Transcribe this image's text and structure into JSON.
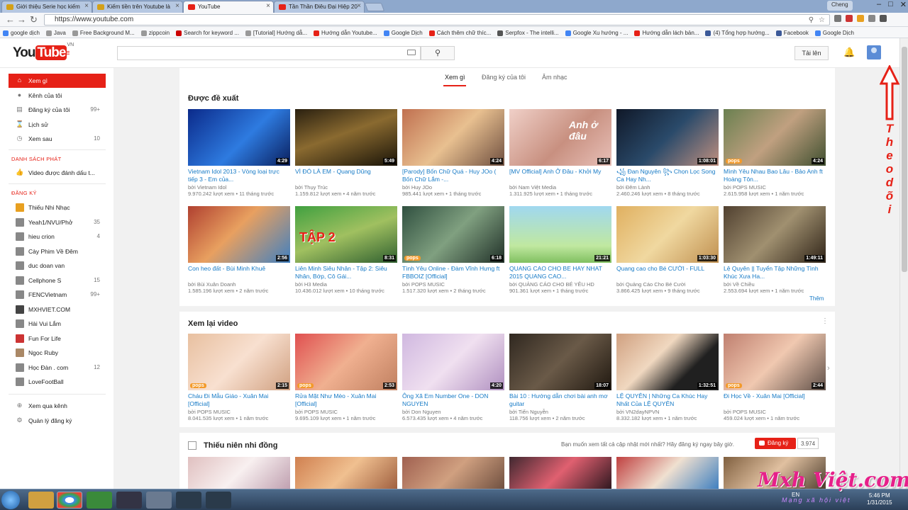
{
  "browser": {
    "tabs": [
      {
        "label": "Giới thiệu Serie học kiếm",
        "fav": "#d4a017"
      },
      {
        "label": "Kiếm tiền trên Youtube là",
        "fav": "#d4a017"
      },
      {
        "label": "YouTube",
        "fav": "#e62117"
      },
      {
        "label": "Tần Thần Điêu Đại Hiệp 20",
        "fav": "#e62117"
      }
    ],
    "user_chip": "Cheng",
    "url": "https://www.youtube.com",
    "bookmarks": [
      {
        "label": "google dịch",
        "color": "#4285f4"
      },
      {
        "label": "Java",
        "color": "#999"
      },
      {
        "label": "Free Background M...",
        "color": "#999"
      },
      {
        "label": "zippcoin",
        "color": "#999"
      },
      {
        "label": "Search for keyword ...",
        "color": "#c00"
      },
      {
        "label": "[Tutorial] Hướng dẫ...",
        "color": "#999"
      },
      {
        "label": "Hướng dẫn Youtube...",
        "color": "#e62117"
      },
      {
        "label": "Google Dịch",
        "color": "#4285f4"
      },
      {
        "label": "Cách thêm chữ thíc...",
        "color": "#e62117"
      },
      {
        "label": "Serpfox - The intelli...",
        "color": "#555"
      },
      {
        "label": "Google Xu hướng - ...",
        "color": "#4285f4"
      },
      {
        "label": "Hướng dẫn lách bản...",
        "color": "#e62117"
      },
      {
        "label": "(4) Tổng hợp hướng...",
        "color": "#3b5998"
      },
      {
        "label": "Facebook",
        "color": "#3b5998"
      },
      {
        "label": "Google Dịch",
        "color": "#4285f4"
      }
    ]
  },
  "yt": {
    "logo_you": "You",
    "logo_tube": "Tube",
    "logo_country": "VN",
    "upload_label": "Tải lên",
    "top_tabs": [
      "Xem gì",
      "Đăng ký của tôi",
      "Âm nhạc"
    ],
    "section_recommended": "Được đề xuất",
    "section_watch_again": "Xem lại video",
    "section_kids": "Thiếu niên nhi đồng",
    "more_label": "Thêm",
    "subscribe_prompt": "Bạn muốn xem tất cả cập nhật mới nhất? Hãy đăng ký ngay bây giờ.",
    "subscribe_label": "Đăng ký",
    "subscribe_count": "3.974"
  },
  "sidebar": {
    "main": [
      {
        "label": "Xem gì",
        "icon": "home-icon",
        "count": ""
      },
      {
        "label": "Kênh của tôi",
        "icon": "user-icon",
        "count": ""
      },
      {
        "label": "Đăng ký của tôi",
        "icon": "subscriptions-icon",
        "count": "99+"
      },
      {
        "label": "Lịch sử",
        "icon": "history-icon",
        "count": ""
      },
      {
        "label": "Xem sau",
        "icon": "clock-icon",
        "count": "10"
      }
    ],
    "playlist_heading": "DANH SÁCH PHÁT",
    "playlists": [
      {
        "label": "Video được đánh dấu t...",
        "icon": "like-icon"
      }
    ],
    "subs_heading": "ĐĂNG KÝ",
    "subscriptions": [
      {
        "label": "Thiếu Nhi Nhạc",
        "count": "",
        "color": "#e8a020"
      },
      {
        "label": "Yeah1/NVU/Phở",
        "count": "35",
        "color": "#888"
      },
      {
        "label": "hieu crion",
        "count": "4",
        "color": "#888"
      },
      {
        "label": "Cày Phim Về Đêm",
        "count": "",
        "color": "#888"
      },
      {
        "label": "duc doan van",
        "count": "",
        "color": "#888"
      },
      {
        "label": "Cellphone S",
        "count": "15",
        "color": "#888"
      },
      {
        "label": "FENCVietnam",
        "count": "99+",
        "color": "#888"
      },
      {
        "label": "MXHVIET.COM",
        "count": "",
        "color": "#444"
      },
      {
        "label": "Hài Vui Lắm",
        "count": "",
        "color": "#888"
      },
      {
        "label": "Fun For Life",
        "count": "",
        "color": "#c33"
      },
      {
        "label": "Ngọc Ruby",
        "count": "",
        "color": "#a86"
      },
      {
        "label": "Học Đàn . com",
        "count": "12",
        "color": "#888"
      },
      {
        "label": "LoveFootBall",
        "count": "",
        "color": "#888"
      }
    ],
    "footer": [
      {
        "label": "Xem qua kênh",
        "icon": "plus-circle-icon"
      },
      {
        "label": "Quản lý đăng ký",
        "icon": "gear-icon"
      }
    ]
  },
  "videos_row1": [
    {
      "title": "Vietnam Idol 2013 - Vòng loại trực tiếp 3 - Em của...",
      "channel": "bởi Vietnam Idol",
      "views": "9.970.242 lượt xem",
      "age": "11 tháng trước",
      "duration": "4:29",
      "pops": false,
      "bg": "linear-gradient(135deg,#0b2a8a,#2e7be0 55%,#0a1f5e)",
      "overlay": ""
    },
    {
      "title": "VÌ ĐÓ LÀ EM - Quang Dũng",
      "channel": "bởi Thụy Trúc",
      "views": "1.159.812 lượt xem",
      "age": "4 năm trước",
      "duration": "5:49",
      "pops": false,
      "bg": "linear-gradient(160deg,#2a2010,#8a6a30 45%,#1a1408)",
      "overlay": ""
    },
    {
      "title": "[Parody] Bốn Chữ Quá - Huy JOo ( Bốn Chữ Lắm -...",
      "channel": "bởi Huy JOo",
      "views": "985.441 lượt xem",
      "age": "1 tháng trước",
      "duration": "4:24",
      "pops": false,
      "bg": "linear-gradient(135deg,#c07050,#e8c090 50%,#705040)",
      "overlay": ""
    },
    {
      "title": "[MV Official] Anh Ở Đâu - Khởi My",
      "channel": "bởi Nam Việt Media",
      "views": "1.311.925 lượt xem",
      "age": "1 tháng trước",
      "duration": "6:17",
      "pops": false,
      "bg": "linear-gradient(135deg,#f0d0c8,#c89080 55%,#e8c0b8)",
      "overlay": "Anh ở đâu"
    },
    {
      "title": "꧁ Đan Nguyên ꧂ Chọn Lọc Song Ca Hay Nh...",
      "channel": "bởi Đêm Lành",
      "views": "2.460.246 lượt xem",
      "age": "8 tháng trước",
      "duration": "1:08:01",
      "pops": false,
      "bg": "linear-gradient(135deg,#101828,#2a4a6a 50%,#c09080)",
      "overlay": ""
    },
    {
      "title": "Mình Yêu Nhau Bao Lâu - Bảo Anh ft Hoàng Tôn...",
      "channel": "bởi POPS MUSIC",
      "views": "2.615.958 lượt xem",
      "age": "1 năm trước",
      "duration": "4:24",
      "pops": true,
      "bg": "linear-gradient(135deg,#6a8050,#c0a080 50%,#405030)",
      "overlay": ""
    }
  ],
  "videos_row2": [
    {
      "title": "Con heo đất - Bùi Minh Khuê",
      "channel": "bởi Bùi Xuân Doanh",
      "views": "1.585.196 lượt xem",
      "age": "2 năm trước",
      "duration": "2:56",
      "pops": false,
      "bg": "linear-gradient(135deg,#b04030,#e8a060 45%,#4080c0)",
      "overlay": ""
    },
    {
      "title": "Liên Minh Siêu Nhân - Tập 2: Siêu Nhân, Bớp, Cô Gái...",
      "channel": "bởi H3 Media",
      "views": "10.436.012 lượt xem",
      "age": "10 tháng trước",
      "duration": "8:31",
      "pops": false,
      "bg": "linear-gradient(160deg,#40a040,#a0c060 50%,#306030)",
      "overlay": "TẬP 2"
    },
    {
      "title": "Tình Yêu Online - Đàm Vĩnh Hưng ft FBBOIZ [Official]",
      "channel": "bởi POPS MUSIC",
      "views": "1.517.320 lượt xem",
      "age": "2 tháng trước",
      "duration": "6:18",
      "pops": true,
      "bg": "linear-gradient(135deg,#305040,#80a080 50%,#203028)",
      "overlay": ""
    },
    {
      "title": "QUANG CAO CHO BE HAY NHAT 2015 QUANG CAO...",
      "channel": "bởi QUẢNG CÁO CHO BÉ YÊU HD",
      "views": "901.361 lượt xem",
      "age": "1 tháng trước",
      "duration": "21:21",
      "pops": false,
      "bg": "linear-gradient(180deg,#a0d8f0,#c0e8a0 70%,#80c060)",
      "overlay": ""
    },
    {
      "title": "Quang cao cho Bé CƯỜI - FULL",
      "channel": "bởi Quảng Cáo Cho Bé Cười",
      "views": "3.866.425 lượt xem",
      "age": "9 tháng trước",
      "duration": "1:03:30",
      "pops": false,
      "bg": "linear-gradient(135deg,#e0b060,#f0d8a0 50%,#c09050)",
      "overlay": ""
    },
    {
      "title": "Lệ Quyên || Tuyển Tập Những Tình Khúc Xưa Ha...",
      "channel": "bởi Về Chiều",
      "views": "2.553.694 lượt xem",
      "age": "1 năm trước",
      "duration": "1:49:11",
      "pops": false,
      "bg": "linear-gradient(135deg,#504030,#a09070 50%,#302418)",
      "overlay": ""
    }
  ],
  "videos_row3": [
    {
      "title": "Cháu Đi Mẫu Giáo - Xuân Mai [Official]",
      "channel": "bởi POPS MUSIC",
      "views": "8.041.535 lượt xem",
      "age": "1 năm trước",
      "duration": "2:15",
      "pops": true,
      "bg": "linear-gradient(135deg,#e8c0a0,#f8e0d0 50%,#d0a080)",
      "overlay": ""
    },
    {
      "title": "Rửa Mặt Như Mèo - Xuân Mai [Official]",
      "channel": "bởi POPS MUSIC",
      "views": "9.695.109 lượt xem",
      "age": "1 năm trước",
      "duration": "2:53",
      "pops": true,
      "bg": "linear-gradient(135deg,#e05050,#f0b090 50%,#c08060)",
      "overlay": ""
    },
    {
      "title": "Ông Xã Em Number One - DON NGUYEN",
      "channel": "bởi Don Nguyen",
      "views": "6.573.435 lượt xem",
      "age": "4 năm trước",
      "duration": "4:20",
      "pops": false,
      "bg": "linear-gradient(135deg,#d0b8e0,#f0e0f0 50%,#b090c0)",
      "overlay": ""
    },
    {
      "title": "Bài 10 : Hướng dẫn chơi bài anh mơ guitar",
      "channel": "bởi Tiến Nguyễn",
      "views": "118.756 lượt xem",
      "age": "2 năm trước",
      "duration": "18:07",
      "pops": false,
      "bg": "linear-gradient(135deg,#302820,#6a5a48 50%,#201810)",
      "overlay": ""
    },
    {
      "title": "LỆ QUYÊN | Những Ca Khúc Hay Nhất Của LỆ QUYÊN",
      "channel": "bởi VN2dayNPVN",
      "views": "8.332.182 lượt xem",
      "age": "1 năm trước",
      "duration": "1:32:51",
      "pops": false,
      "bg": "linear-gradient(135deg,#d0a080,#f0d8c0 40%,#202020 70%)",
      "overlay": ""
    },
    {
      "title": "Đi Học Về - Xuân Mai [Official]",
      "channel": "bởi POPS MUSIC",
      "views": "459.024 lượt xem",
      "age": "1 năm trước",
      "duration": "2:44",
      "pops": true,
      "bg": "linear-gradient(135deg,#c08070,#f0c8b0 50%,#605048)",
      "overlay": ""
    }
  ],
  "videos_row4_bgs": [
    "linear-gradient(135deg,#e0c0c0,#f8f0f0 50%,#c0a0b0)",
    "linear-gradient(135deg,#d08050,#f0c090 50%,#a06040)",
    "linear-gradient(135deg,#a06050,#d0a080 50%,#705040)",
    "linear-gradient(135deg,#402830,#e06070 50%,#301820)",
    "linear-gradient(135deg,#c04040,#f0e0d0 50%,#4080c0)",
    "linear-gradient(135deg,#806040,#e0c0a0 50%,#504030)"
  ],
  "watermark": {
    "text": "Mxh Việt.com",
    "sub": "Mạng xã hội việt",
    "side": "Theo dõi"
  },
  "taskbar": {
    "lang": "EN",
    "time": "5:46 PM",
    "date": "1/31/2015"
  }
}
